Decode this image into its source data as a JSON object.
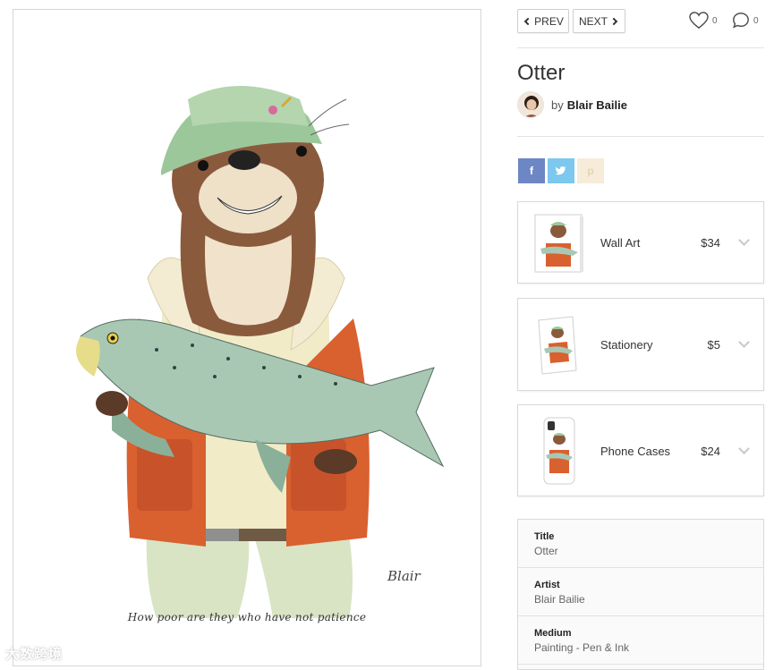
{
  "artwork": {
    "caption": "How poor are they who have not patience",
    "signature": "Blair",
    "watermark": "大数跨境"
  },
  "nav": {
    "prev_label": "PREV",
    "next_label": "NEXT",
    "like_count": "0",
    "comment_count": "0"
  },
  "header": {
    "title": "Otter",
    "by": "by",
    "artist": "Blair Bailie"
  },
  "share": {
    "facebook": "f",
    "twitter": "t",
    "pinterest": "p"
  },
  "products": [
    {
      "name": "Wall Art",
      "price": "$34"
    },
    {
      "name": "Stationery",
      "price": "$5"
    },
    {
      "name": "Phone Cases",
      "price": "$24"
    }
  ],
  "details": [
    {
      "label": "Title",
      "value": "Otter"
    },
    {
      "label": "Artist",
      "value": "Blair Bailie"
    },
    {
      "label": "Medium",
      "value": "Painting - Pen & Ink"
    }
  ],
  "colors": {
    "facebook": "#6d86c4",
    "twitter": "#7cc8ee",
    "pinterest": "#f6ecd9",
    "vest": "#d9602f",
    "hat": "#9cc79a"
  }
}
